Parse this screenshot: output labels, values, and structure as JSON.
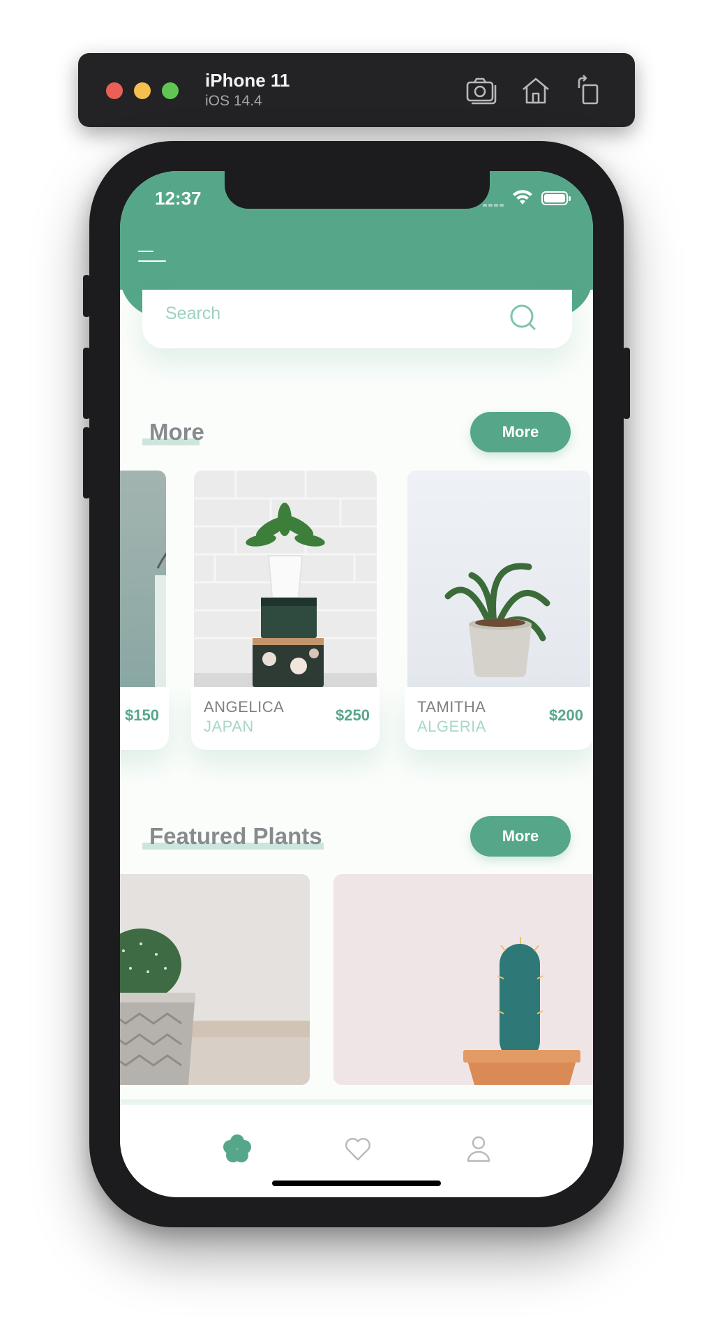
{
  "simulator": {
    "device_name": "iPhone 11",
    "os_version": "iOS 14.4",
    "icons": [
      "screenshot-icon",
      "home-icon",
      "rotate-icon"
    ]
  },
  "status_bar": {
    "time": "12:37"
  },
  "colors": {
    "primary": "#56a78a",
    "light_accent": "#a6d8c5",
    "title_gray": "#868b8e"
  },
  "search": {
    "placeholder": "Search"
  },
  "sections": {
    "more": {
      "title": "More",
      "button_label": "More",
      "cards": [
        {
          "price": "$150"
        },
        {
          "name": "ANGELICA",
          "country": "JAPAN",
          "price": "$250"
        },
        {
          "name": "TAMITHA",
          "country": "ALGERIA",
          "price": "$200"
        }
      ]
    },
    "featured": {
      "title": "Featured Plants",
      "button_label": "More"
    }
  },
  "bottom_nav": {
    "items": [
      {
        "icon": "flower-icon",
        "active": true
      },
      {
        "icon": "heart-icon",
        "active": false
      },
      {
        "icon": "profile-icon",
        "active": false
      }
    ]
  }
}
